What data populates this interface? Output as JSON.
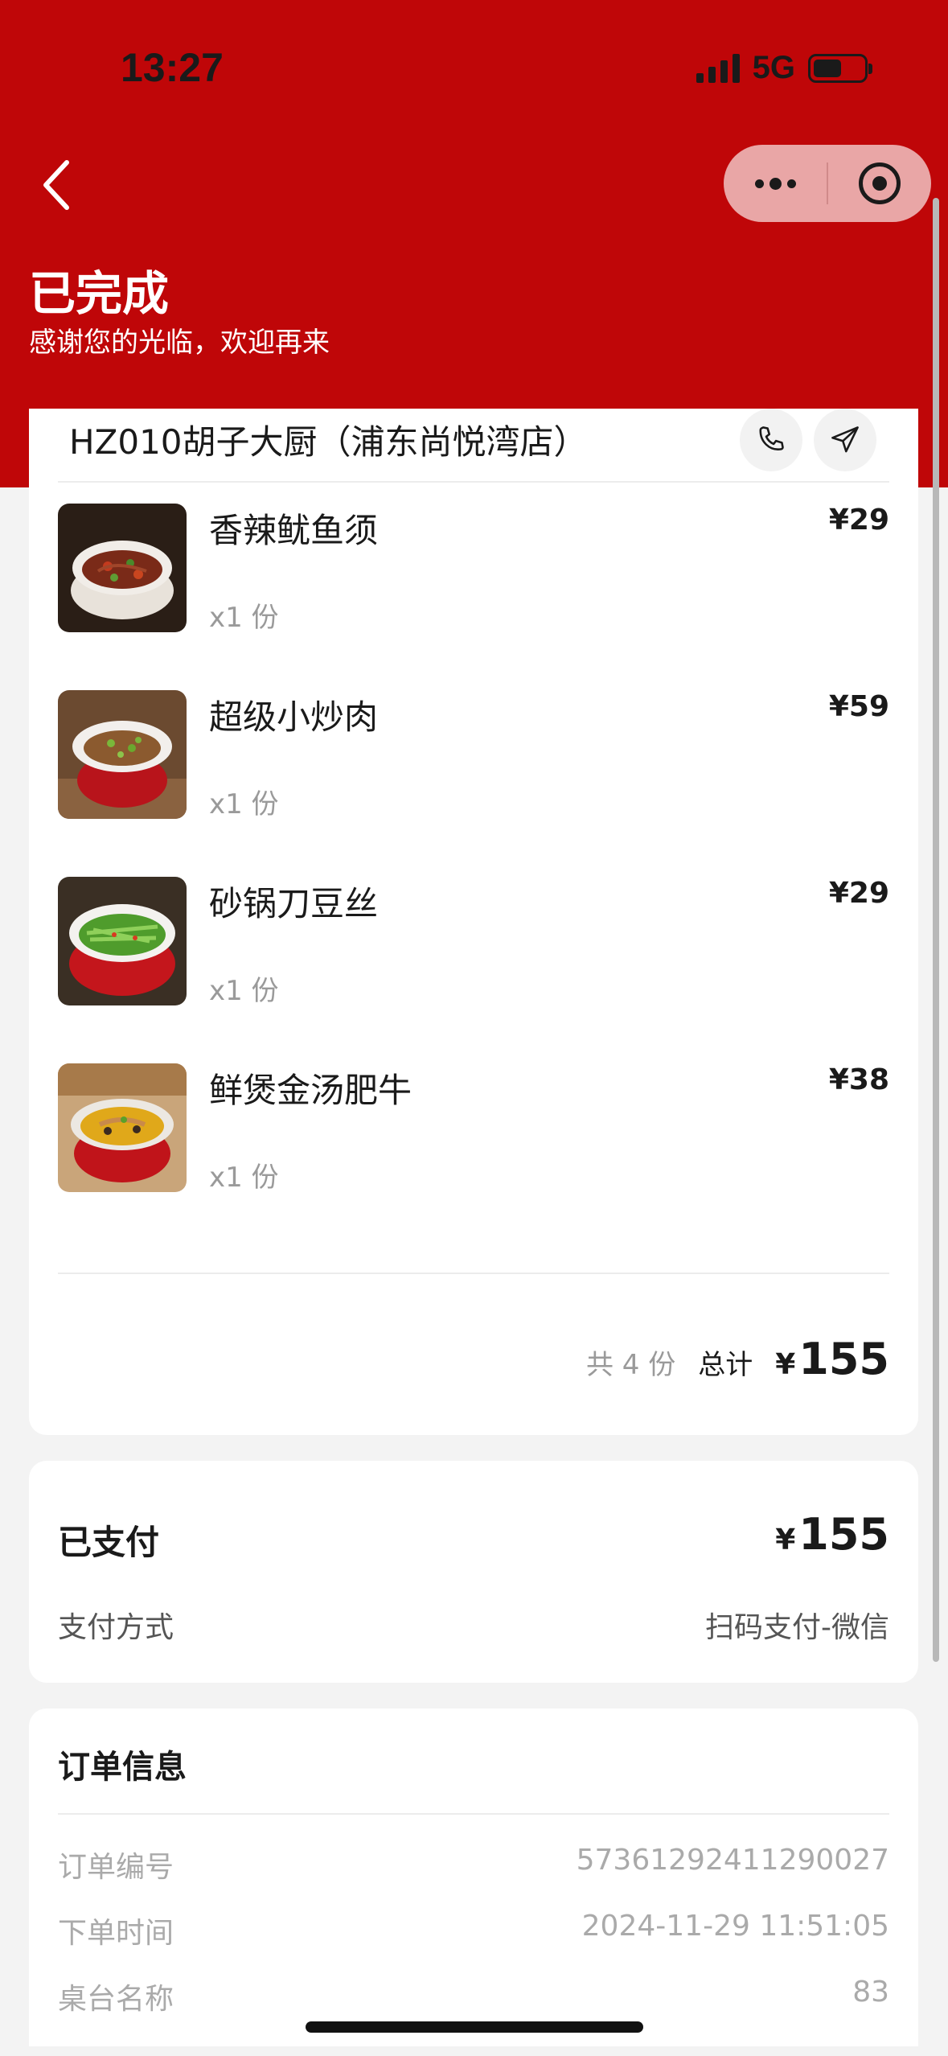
{
  "status_bar": {
    "time": "13:27",
    "network": "5G"
  },
  "header": {
    "title": "已完成",
    "subtitle": "感谢您的光临，欢迎再来",
    "back_icon": "chevron-left-icon",
    "menu_icon": "more-dots-icon",
    "close_icon": "target-circle-icon",
    "accent_color": "#bf0608"
  },
  "store": {
    "name": "HZ010胡子大厨（浦东尚悦湾店）",
    "phone_icon": "phone-icon",
    "nav_icon": "navigation-arrow-icon"
  },
  "items": [
    {
      "name": "香辣鱿鱼须",
      "qty": "x1 份",
      "price": "¥29"
    },
    {
      "name": "超级小炒肉",
      "qty": "x1 份",
      "price": "¥59"
    },
    {
      "name": "砂锅刀豆丝",
      "qty": "x1 份",
      "price": "¥29"
    },
    {
      "name": "鲜煲金汤肥牛",
      "qty": "x1 份",
      "price": "¥38"
    }
  ],
  "summary": {
    "count": "共 4 份",
    "total_label": "总计",
    "yen": "¥",
    "total": "155"
  },
  "payment": {
    "title": "已支付",
    "yen": "¥",
    "amount": "155",
    "method_label": "支付方式",
    "method_value": "扫码支付-微信"
  },
  "order_info": {
    "title": "订单信息",
    "rows": [
      {
        "label": "订单编号",
        "value": "57361292411290027"
      },
      {
        "label": "下单时间",
        "value": "2024-11-29 11:51:05"
      },
      {
        "label": "桌台名称",
        "value": "83"
      }
    ]
  }
}
